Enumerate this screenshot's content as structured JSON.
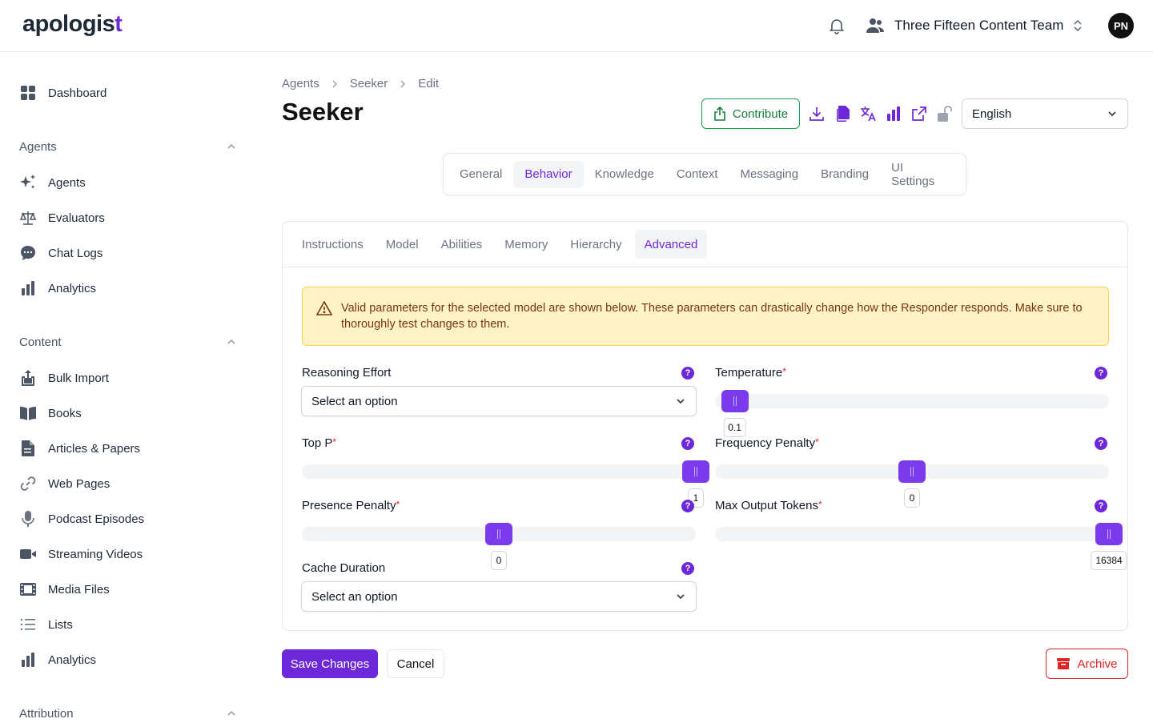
{
  "app": {
    "logo": "apologis",
    "logo_cross": "t"
  },
  "header": {
    "team_name": "Three Fifteen Content Team",
    "avatar_initials": "PN"
  },
  "sidebar": {
    "dashboard": "Dashboard",
    "agents_section": "Agents",
    "agents_items": [
      "Agents",
      "Evaluators",
      "Chat Logs",
      "Analytics"
    ],
    "content_section": "Content",
    "content_items": [
      "Bulk Import",
      "Books",
      "Articles & Papers",
      "Web Pages",
      "Podcast Episodes",
      "Streaming Videos",
      "Media Files",
      "Lists",
      "Analytics"
    ],
    "attribution_section": "Attribution"
  },
  "breadcrumb": [
    "Agents",
    "Seeker",
    "Edit"
  ],
  "page_title": "Seeker",
  "toolbar": {
    "contribute": "Contribute",
    "language": "English"
  },
  "main_tabs": [
    "General",
    "Behavior",
    "Knowledge",
    "Context",
    "Messaging",
    "Branding",
    "UI Settings"
  ],
  "main_tab_active": "Behavior",
  "sub_tabs": [
    "Instructions",
    "Model",
    "Abilities",
    "Memory",
    "Hierarchy",
    "Advanced"
  ],
  "sub_tab_active": "Advanced",
  "alert": "Valid parameters for the selected model are shown below. These parameters can drastically change how the Responder responds. Make sure to thoroughly test changes to them.",
  "fields": {
    "reasoning_effort": {
      "label": "Reasoning Effort",
      "placeholder": "Select an option"
    },
    "temperature": {
      "label": "Temperature",
      "value": "0.1",
      "fraction": 0.05
    },
    "top_p": {
      "label": "Top P",
      "value": "1",
      "fraction": 1.0
    },
    "frequency_penalty": {
      "label": "Frequency Penalty",
      "value": "0",
      "fraction": 0.5
    },
    "presence_penalty": {
      "label": "Presence Penalty",
      "value": "0",
      "fraction": 0.5
    },
    "max_output_tokens": {
      "label": "Max Output Tokens",
      "value": "16384",
      "fraction": 1.0
    },
    "cache_duration": {
      "label": "Cache Duration",
      "placeholder": "Select an option"
    },
    "required_mark": "*",
    "help_glyph": "?"
  },
  "actions": {
    "save": "Save Changes",
    "cancel": "Cancel",
    "archive": "Archive"
  },
  "colors": {
    "accent": "#6d28d9",
    "success": "#15803d",
    "danger": "#dc2626",
    "warning_bg": "#fef3c7"
  }
}
